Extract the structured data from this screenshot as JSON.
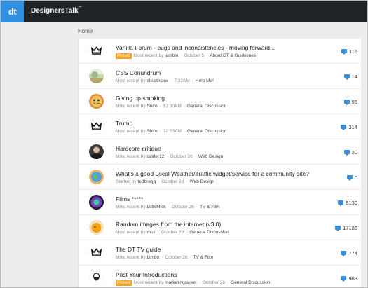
{
  "header": {
    "logo_text": "dt",
    "brand_name": "DesignersTalk",
    "brand_mark": "™"
  },
  "breadcrumb": "Home",
  "separator": "·",
  "threads": [
    {
      "title": "Vanilla Forum - bugs and inconsistencies - moving forward...",
      "pinned": "Pinned",
      "meta_prefix": "Most recent by",
      "user": "jamblo",
      "time": "October 5",
      "category": "About DT & Guidelines",
      "count": "115",
      "avatar": "crown-icon"
    },
    {
      "title": "CSS Conundrum",
      "pinned": "",
      "meta_prefix": "Most recent by",
      "user": "stealthcow",
      "time": "7:32AM",
      "category": "Help Me!",
      "count": "14",
      "avatar": "landscape-avatar"
    },
    {
      "title": "Giving up smoking",
      "pinned": "",
      "meta_prefix": "Most recent by",
      "user": "Shiro",
      "time": "12:30AM",
      "category": "General Discussion",
      "count": "95",
      "avatar": "face-avatar"
    },
    {
      "title": "Trump",
      "pinned": "",
      "meta_prefix": "Most recent by",
      "user": "Shiro",
      "time": "12:23AM",
      "category": "General Discussion",
      "count": "314",
      "avatar": "crown-icon"
    },
    {
      "title": "Hardcore critique",
      "pinned": "",
      "meta_prefix": "Most recent by",
      "user": "calder12",
      "time": "October 26",
      "category": "Web Design",
      "count": "20",
      "avatar": "person-avatar"
    },
    {
      "title": "What's a good Local Weather/Traffic widget/service for a community site?",
      "pinned": "",
      "meta_prefix": "Started by",
      "user": "tedbragg",
      "time": "October 26",
      "category": "Web Design",
      "count": "0",
      "avatar": "globe-avatar"
    },
    {
      "title": "Films *****",
      "pinned": "",
      "meta_prefix": "Most recent by",
      "user": "LittleMick",
      "time": "October 26",
      "category": "TV & Film",
      "count": "5130",
      "avatar": "purple-avatar"
    },
    {
      "title": "Random images from the internet (v3.0)",
      "pinned": "",
      "meta_prefix": "Most recent by",
      "user": "moz",
      "time": "October 26",
      "category": "General Discussion",
      "count": "17186",
      "avatar": "yellow-avatar"
    },
    {
      "title": "The DT TV guide",
      "pinned": "",
      "meta_prefix": "Most recent by",
      "user": "Limbo",
      "time": "October 26",
      "category": "TV & Film",
      "count": "774",
      "avatar": "crown-icon"
    },
    {
      "title": "Post Your Introductions",
      "pinned": "Pinned",
      "meta_prefix": "Most recent by",
      "user": "marketingsweet",
      "time": "October 26",
      "category": "General Discussion",
      "count": "963",
      "avatar": "bearded-avatar"
    }
  ],
  "colors": {
    "topbar": "#1f2326",
    "logo_bg": "#2f8fe0",
    "pinned": "#f6a21e",
    "comment_icon": "#3a8fd8"
  }
}
